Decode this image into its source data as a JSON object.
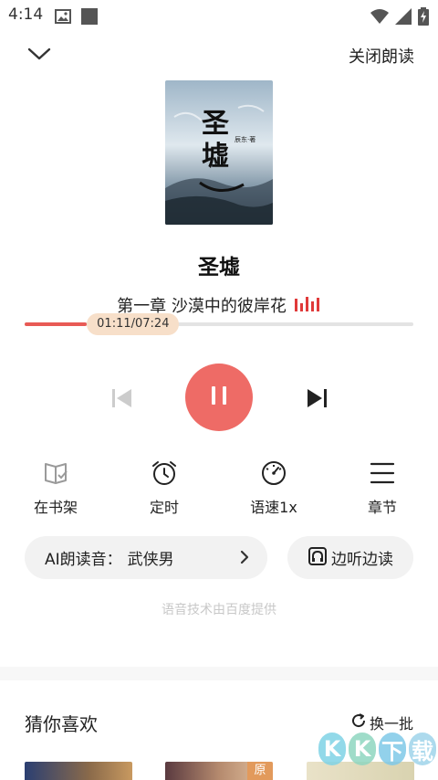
{
  "status_bar": {
    "time": "4:14",
    "left_icons": [
      "image-icon",
      "square-icon"
    ],
    "right_icons": [
      "wifi-icon",
      "signal-icon",
      "battery-charging-icon"
    ]
  },
  "header": {
    "collapse_icon": "chevron-down-icon",
    "close_reading_label": "关闭朗读"
  },
  "book": {
    "title": "圣墟",
    "cover_text": "圣墟",
    "cover_author": "辰东·著",
    "chapter": "第一章 沙漠中的彼岸花"
  },
  "progress": {
    "time_label": "01:11/07:24",
    "fraction": 0.16
  },
  "controls": {
    "prev_icon": "skip-previous-icon",
    "play_state": "playing",
    "pause_icon": "pause-icon",
    "next_icon": "skip-next-icon"
  },
  "tools": [
    {
      "icon": "bookshelf-check-icon",
      "label": "在书架"
    },
    {
      "icon": "alarm-clock-icon",
      "label": "定时"
    },
    {
      "icon": "speedometer-icon",
      "label": "语速1x"
    },
    {
      "icon": "menu-lines-icon",
      "label": "章节"
    }
  ],
  "voice": {
    "label": "AI朗读音：",
    "value": "武侠男"
  },
  "listen_read": {
    "icon": "headphone-book-icon",
    "label": "边听边读"
  },
  "provider_note": "语音技术由百度提供",
  "recommend": {
    "title": "猜你喜欢",
    "refresh_label": "换一批",
    "badge": "原"
  },
  "watermark": [
    "K",
    "K",
    "下",
    "载"
  ],
  "colors": {
    "accent": "#e85a55",
    "play_button": "#ee6b66",
    "progress_pill": "#f7dfc9",
    "pill_bg": "#f2f2f2",
    "muted_text": "#c8c8c8"
  }
}
